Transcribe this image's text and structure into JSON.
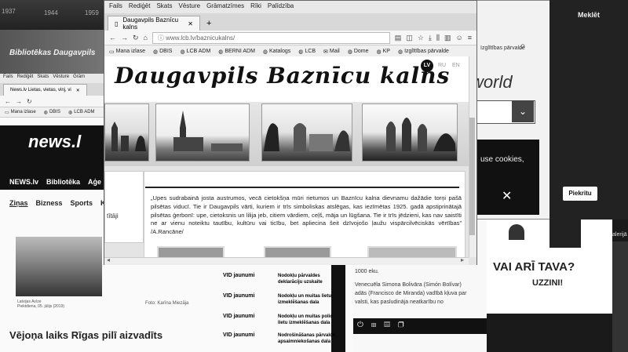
{
  "bg_top": {
    "years": [
      "1937",
      "1944",
      "1959"
    ]
  },
  "back_window": {
    "search_label": "Meklēt",
    "world_text": "world",
    "cookie_text": "use cookies,",
    "cookie_button": "Piekritu",
    "tab_partial": "Izglītības pārvalde",
    "ad_title": "VAI ARĪ TAVA?",
    "ad_subtitle": "UZZINI!",
    "right_edge_text": "alerijā"
  },
  "left_banner": {
    "text": "Bibliotēkas Daugavpils"
  },
  "news_window": {
    "menu": [
      "Fails",
      "Rediģēt",
      "Skats",
      "Vēsture",
      "Grām"
    ],
    "tab_title": "News.lv Lietas, vietas, vinj, vi",
    "bookmarks": [
      "Mana izlase",
      "DBIS",
      "LCB ADM"
    ],
    "logo": "news.l",
    "nav1": [
      "NEWS.lv",
      "Bibliotēka",
      "Aģe"
    ],
    "nav2": [
      "Ziņas",
      "Bizness",
      "Sports",
      "K"
    ],
    "caption_left": "Latvijas Avīze\nPiektdiena, 05. jūlijs (2019)",
    "caption_right": "Foto: Karīna Miezāja",
    "headline": "Vējoņa laiks Rīgas pilī aizvadīts"
  },
  "vid_table": {
    "rows": [
      {
        "source": "VID jaunumi",
        "title": "Nodokļu pārvaldes deklarāciju uzskaite"
      },
      {
        "source": "VID jaunumi",
        "title": "Nodokļu un muitas lietu izmeklēšanas dala"
      },
      {
        "source": "VID jaunumi",
        "title": "Nodokļu un muitas polic lietu izmeklēšanas dala"
      },
      {
        "source": "VID jaunumi",
        "title": "Nodrošināšanas pārvalde apsaimniekošanas dala"
      }
    ]
  },
  "middle_right_text": {
    "line1": "1000 eku.",
    "line2": "Venecuēla Simona Bolivāra (Simón Bolívar)",
    "line3": "adās (Francisco de Miranda) vadībā kļuva par",
    "line4": "valsti, kas pasludināja neatkarību no"
  },
  "main_window": {
    "menu": [
      "Fails",
      "Rediģēt",
      "Skats",
      "Vēsture",
      "Grāmatzīmes",
      "Rīki",
      "Palīdzība"
    ],
    "tab_title": "Daugavpils Baznīcu kalns",
    "url": "www.lcb.lv/baznicukalns/",
    "bookmarks": [
      "Mana izlase",
      "DBIS",
      "LCB ADM",
      "BERNI ADM",
      "Katalogs",
      "LCB",
      "Mail",
      "Dome",
      "KP",
      "Izglītības pārvalde"
    ],
    "site_title": "Daugavpils Baznīcu kalns",
    "lang_buttons": [
      "LV",
      "RU",
      "EN"
    ],
    "side_links": [
      "tītāji"
    ],
    "quote": "„Upes sudrabainā josta austrumos, vecā cietokšņa mūri rietumos un Baznīcu kalna dievnamu dažādie torņi pašā pilsētas viducī. Tie ir Daugavpils vārti, kuriem ir trīs simboliskas atslēgas, kas iezīmētas 1925. gadā apstiprinātajā pilsētas ģerbonī: upe, cietoksnis un lilija jeb, citiem vārdiem, ceļš, māja un lūgšana. Tie ir trīs jēdzieni, kas nav saistīti ne ar vienu noteiktu tautību, kultūru vai ticību, bet apliecina šeit dzīvojošo ļaužu vispārcilvēciskās vērtības” /A.Rancāne/"
  }
}
